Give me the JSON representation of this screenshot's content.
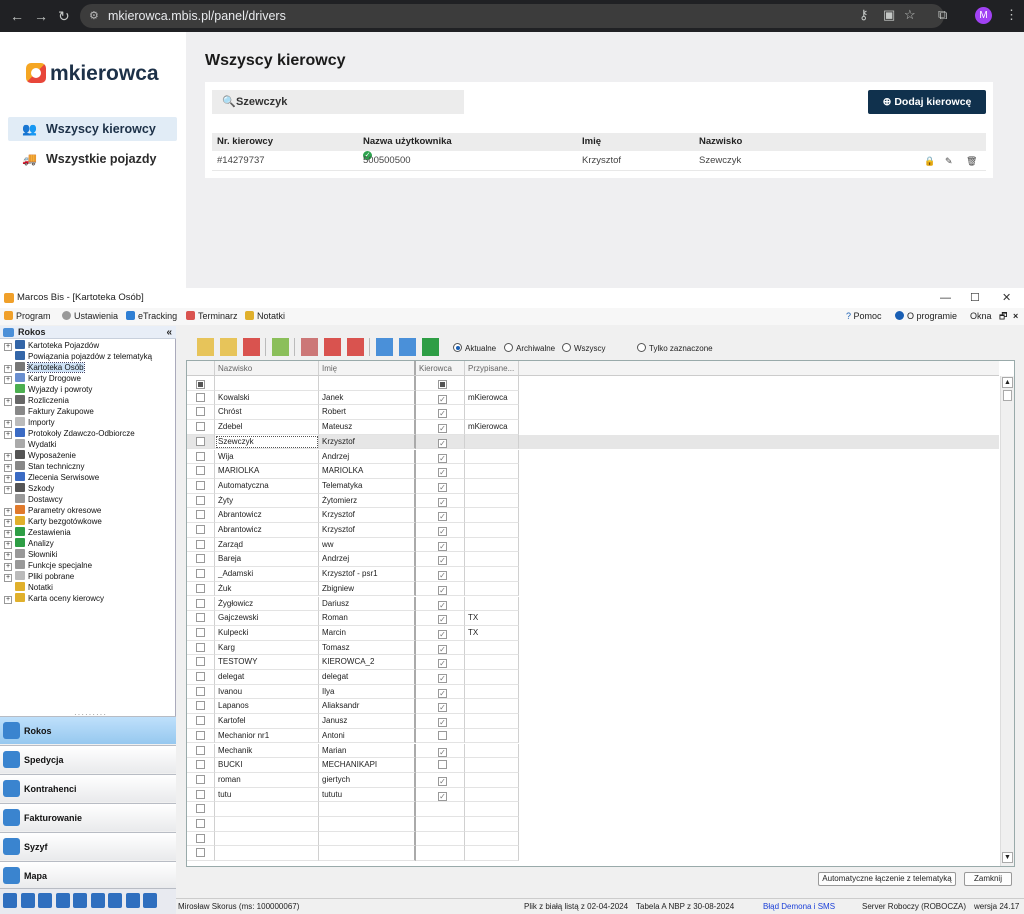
{
  "browser": {
    "url": "mkierowca.mbis.pl/panel/drivers",
    "avatar": "M"
  },
  "web": {
    "logo": "mkierowca",
    "nav": [
      {
        "label": "Wszyscy kierowcy",
        "icon": "users-icon",
        "active": true
      },
      {
        "label": "Wszystkie pojazdy",
        "icon": "truck-icon",
        "active": false
      }
    ],
    "title": "Wszyscy kierowcy",
    "search_value": "Szewczyk",
    "add_button": "Dodaj kierowcę",
    "table": {
      "headers": [
        "Nr. kierowcy",
        "Nazwa użytkownika",
        "Imię",
        "Nazwisko"
      ],
      "rows": [
        {
          "nr": "#14279737",
          "user": "500500500",
          "first": "Krzysztof",
          "last": "Szewczyk"
        }
      ]
    }
  },
  "app": {
    "title": "Marcos Bis - [Kartoteka Osób]",
    "menu": [
      "Program",
      "Ustawienia",
      "eTracking",
      "Terminarz",
      "Notatki"
    ],
    "menu_right": [
      "Pomoc",
      "O programie",
      "Okna"
    ],
    "tree_header": "Rokos",
    "tree": [
      {
        "label": "Kartoteka Pojazdów",
        "exp": true,
        "color": "#3466a8"
      },
      {
        "label": "Powiązania pojazdów z telematyką",
        "exp": false,
        "color": "#3466a8"
      },
      {
        "label": "Kartoteka Osób",
        "exp": true,
        "color": "#777",
        "selected": true
      },
      {
        "label": "Karty Drogowe",
        "exp": true,
        "color": "#6a8fd0"
      },
      {
        "label": "Wyjazdy i powroty",
        "exp": false,
        "color": "#4caf50"
      },
      {
        "label": "Rozliczenia",
        "exp": true,
        "color": "#666"
      },
      {
        "label": "Faktury Zakupowe",
        "exp": false,
        "color": "#888"
      },
      {
        "label": "Importy",
        "exp": true,
        "color": "#bbb"
      },
      {
        "label": "Protokoły Zdawczo-Odbiorcze",
        "exp": true,
        "color": "#3b6bc4"
      },
      {
        "label": "Wydatki",
        "exp": false,
        "color": "#aaa"
      },
      {
        "label": "Wyposażenie",
        "exp": true,
        "color": "#555"
      },
      {
        "label": "Stan techniczny",
        "exp": true,
        "color": "#888"
      },
      {
        "label": "Zlecenia Serwisowe",
        "exp": true,
        "color": "#3b6bc4"
      },
      {
        "label": "Szkody",
        "exp": true,
        "color": "#555"
      },
      {
        "label": "Dostawcy",
        "exp": false,
        "color": "#999"
      },
      {
        "label": "Parametry okresowe",
        "exp": true,
        "color": "#e07a2c"
      },
      {
        "label": "Karty bezgotówkowe",
        "exp": true,
        "color": "#e0b02c"
      },
      {
        "label": "Zestawienia",
        "exp": true,
        "color": "#2e9e45"
      },
      {
        "label": "Analizy",
        "exp": true,
        "color": "#2e9e45"
      },
      {
        "label": "Słowniki",
        "exp": true,
        "color": "#999"
      },
      {
        "label": "Funkcje specjalne",
        "exp": true,
        "color": "#999"
      },
      {
        "label": "Pliki pobrane",
        "exp": true,
        "color": "#bbb"
      },
      {
        "label": "Notatki",
        "exp": false,
        "color": "#e0b02c"
      },
      {
        "label": "Karta oceny kierowcy",
        "exp": true,
        "color": "#e0b02c"
      }
    ],
    "modules": [
      "Rokos",
      "Spedycja",
      "Kontrahenci",
      "Fakturowanie",
      "Syzyf",
      "Mapa"
    ],
    "filters": {
      "radios": [
        "Aktualne",
        "Archiwalne",
        "Wszyscy"
      ],
      "selected": "Aktualne",
      "checkbox": "Tylko zaznaczone"
    },
    "grid_headers": [
      "",
      "Nazwisko",
      "Imię",
      "Kierowca",
      "Przypisane..."
    ],
    "grid_rows": [
      {
        "last": "Kowalski",
        "first": "Janek",
        "driver": true,
        "assigned": "mKierowca"
      },
      {
        "last": "Chróst",
        "first": "Robert",
        "driver": true,
        "assigned": ""
      },
      {
        "last": "Zdebel",
        "first": "Mateusz",
        "driver": true,
        "assigned": "mKierowca"
      },
      {
        "last": "Szewczyk",
        "first": "Krzysztof",
        "driver": true,
        "assigned": "",
        "selected": true
      },
      {
        "last": "Wija",
        "first": "Andrzej",
        "driver": true,
        "assigned": ""
      },
      {
        "last": "MARIOLKA",
        "first": "MARIOLKA",
        "driver": true,
        "assigned": ""
      },
      {
        "last": "Automatyczna",
        "first": "Telematyka",
        "driver": true,
        "assigned": ""
      },
      {
        "last": "Żyty",
        "first": "Żytomierz",
        "driver": true,
        "assigned": ""
      },
      {
        "last": "Abrantowicz",
        "first": "Krzysztof",
        "driver": true,
        "assigned": ""
      },
      {
        "last": "Abrantowicz",
        "first": "Krzysztof",
        "driver": true,
        "assigned": ""
      },
      {
        "last": "Zarząd",
        "first": "ww",
        "driver": true,
        "assigned": ""
      },
      {
        "last": "Bareja",
        "first": "Andrzej",
        "driver": true,
        "assigned": ""
      },
      {
        "last": "_Adamski",
        "first": "Krzysztof - psr1",
        "driver": true,
        "assigned": ""
      },
      {
        "last": "Żuk",
        "first": "Zbigniew",
        "driver": true,
        "assigned": ""
      },
      {
        "last": "Żygłowicz",
        "first": "Dariusz",
        "driver": true,
        "assigned": ""
      },
      {
        "last": "Gajczewski",
        "first": "Roman",
        "driver": true,
        "assigned": "TX"
      },
      {
        "last": "Kulpecki",
        "first": "Marcin",
        "driver": true,
        "assigned": "TX"
      },
      {
        "last": "Karg",
        "first": "Tomasz",
        "driver": true,
        "assigned": ""
      },
      {
        "last": "TESTOWY",
        "first": "KIEROWCA_2",
        "driver": true,
        "assigned": ""
      },
      {
        "last": "delegat",
        "first": "delegat",
        "driver": true,
        "assigned": ""
      },
      {
        "last": "Ivanou",
        "first": "Ilya",
        "driver": true,
        "assigned": ""
      },
      {
        "last": "Lapanos",
        "first": "Aliaksandr",
        "driver": true,
        "assigned": ""
      },
      {
        "last": "Kartofel",
        "first": "Janusz",
        "driver": true,
        "assigned": ""
      },
      {
        "last": "Mechanior nr1",
        "first": "Antoni",
        "driver": false,
        "assigned": ""
      },
      {
        "last": "Mechanik",
        "first": "Marian",
        "driver": true,
        "assigned": ""
      },
      {
        "last": "BUCKI",
        "first": "MECHANIKAPI",
        "driver": false,
        "assigned": ""
      },
      {
        "last": "roman",
        "first": "giertych",
        "driver": true,
        "assigned": ""
      },
      {
        "last": "tutu",
        "first": "tututu",
        "driver": true,
        "assigned": ""
      },
      {
        "last": "",
        "first": "",
        "driver": null,
        "assigned": ""
      },
      {
        "last": "",
        "first": "",
        "driver": null,
        "assigned": ""
      },
      {
        "last": "",
        "first": "",
        "driver": null,
        "assigned": ""
      },
      {
        "last": "",
        "first": "",
        "driver": null,
        "assigned": ""
      }
    ],
    "buttons": {
      "auto": "Automatyczne łączenie z telematyką",
      "close": "Zamknij"
    },
    "status": {
      "user": "Mirosław Skorus (ms: 100000067)",
      "whitelist": "Plik z białą listą z 02-04-2024",
      "nbp": "Tabela A NBP z 30-08-2024",
      "error": "Błąd Demona i SMS",
      "server": "Server Roboczy (ROBOCZA)",
      "version": "wersja 24.17"
    }
  }
}
